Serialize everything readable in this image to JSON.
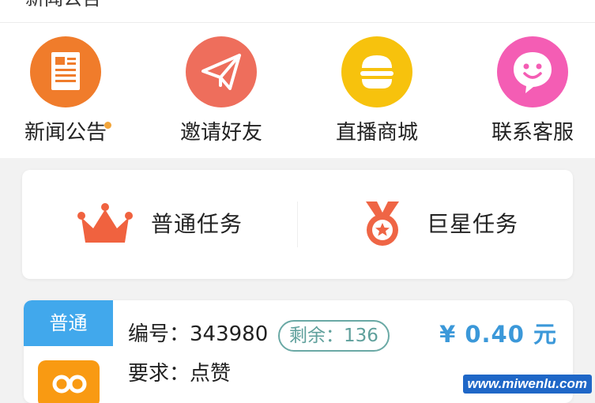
{
  "top_strip": {
    "cut_text": "新闻公告"
  },
  "quick_menu": [
    {
      "label": "新闻公告",
      "icon": "news-document-icon",
      "color": "#f07c2b",
      "has_dot": true
    },
    {
      "label": "邀请好友",
      "icon": "paper-plane-icon",
      "color": "#ee6e5c",
      "has_dot": false
    },
    {
      "label": "直播商城",
      "icon": "burger-icon",
      "color": "#f7c20d",
      "has_dot": false
    },
    {
      "label": "联系客服",
      "icon": "smiley-chat-icon",
      "color": "#f45db4",
      "has_dot": false
    }
  ],
  "task_types": [
    {
      "label": "普通任务",
      "icon": "crown-icon",
      "color": "#f0623f"
    },
    {
      "label": "巨星任务",
      "icon": "medal-icon",
      "color": "#ef6545"
    }
  ],
  "task": {
    "badge": "普通",
    "id_line": "编号：343980",
    "remaining": "剩余：136",
    "price": "¥ 0.40 元",
    "requirement": "要求：点赞",
    "app_icon": "video-app-icon",
    "badge_color": "#41a8ec",
    "price_color": "#3b98d9"
  },
  "watermark": "www.miwenlu.com"
}
